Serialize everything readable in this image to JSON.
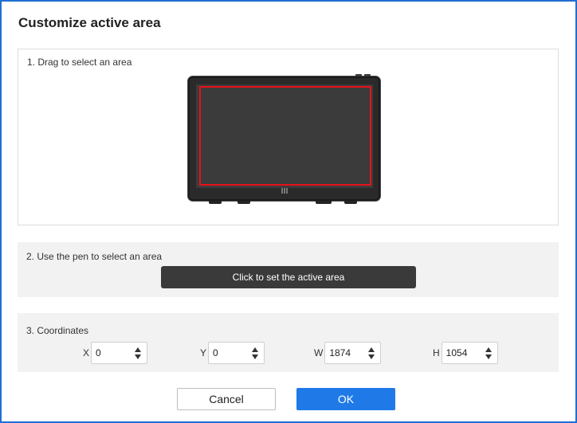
{
  "dialog": {
    "title": "Customize active area"
  },
  "section1": {
    "label": "1. Drag to select an area",
    "selection_color": "#e8101a"
  },
  "section2": {
    "label": "2. Use the pen to select an area",
    "button_label": "Click to set the active area"
  },
  "section3": {
    "label": "3. Coordinates",
    "fields": [
      {
        "label": "X",
        "value": "0"
      },
      {
        "label": "Y",
        "value": "0"
      },
      {
        "label": "W",
        "value": "1874"
      },
      {
        "label": "H",
        "value": "1054"
      }
    ]
  },
  "footer": {
    "cancel_label": "Cancel",
    "ok_label": "OK",
    "ok_color": "#1f7ae8"
  },
  "icons": {
    "spin_arrows": "up-down-arrows-icon"
  }
}
